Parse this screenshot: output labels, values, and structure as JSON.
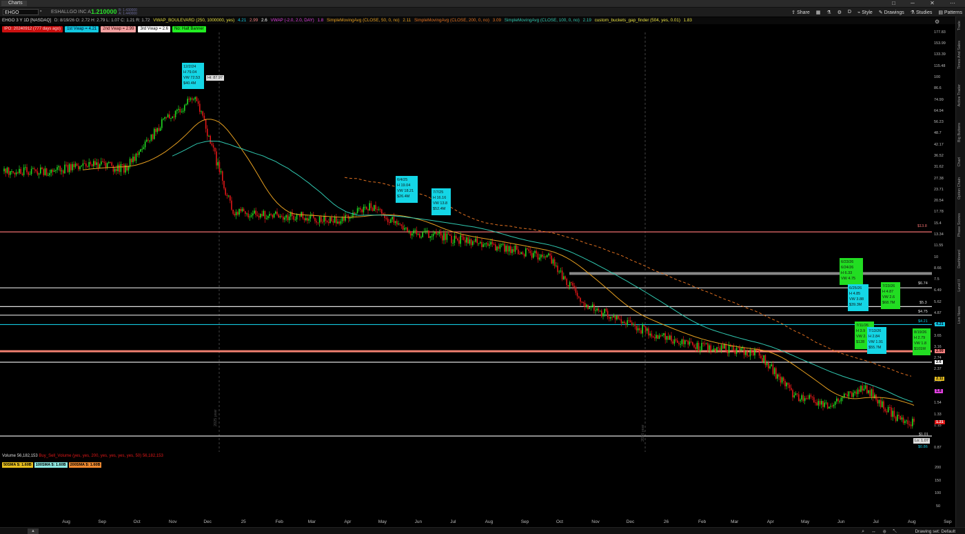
{
  "window": {
    "tab": "Charts"
  },
  "toolbar": {
    "symbol": "EHGO",
    "company": "ESHALLGO INC A",
    "last_price": "1.210000",
    "mini_quote": [
      "B: 1.430000",
      "A: 1.440000"
    ],
    "share": "Share",
    "style": "Style",
    "drawings": "Drawings",
    "studies": "Studies",
    "patterns": "Patterns",
    "d_label": "D"
  },
  "infobar": {
    "title": "EHGO 3 Y 1D [NASDAQ]",
    "ohlc": "D: 8/19/26  O: 2.72  H: 2.79  L: 1.07  C: 1.21  R: 1.72",
    "vwap_blvd": "VWAP_BOULEVARD (250, 1000000, yes)",
    "vwap_blvd_vals": [
      "4.21",
      "2.99",
      "2.6"
    ],
    "vwap": "VWAP (-2.0, 2.0, DAY)",
    "vwap_val": "1.8",
    "sma50": "SimpleMovingAvg (CLOSE, 50, 0, no)",
    "sma50_val": "2.11",
    "sma200": "SimpleMovingAvg (CLOSE, 200, 0, no)",
    "sma200_val": "3.09",
    "sma100": "SimpleMovingAvg (CLOSE, 100, 0, no)",
    "sma100_val": "2.19",
    "gap": "custom_buckets_gap_finder (504, yes, 0.01)",
    "gap_val": "1.83"
  },
  "chips": [
    {
      "text": "IPO: 20240912 (777 days ago)",
      "bg": "#cc1010",
      "fg": "#ffcccc"
    },
    {
      "text": "1st Vwap = 4.21",
      "bg": "#12c8e0",
      "fg": "#002"
    },
    {
      "text": "2nd Vwap = 2.99",
      "bg": "#f2a0a0",
      "fg": "#300"
    },
    {
      "text": "3rd Vwap = 2.6",
      "bg": "#ffffff",
      "fg": "#000"
    },
    {
      "text": "No: Halt Banner",
      "bg": "#22ee22",
      "fg": "#000"
    }
  ],
  "callouts": [
    {
      "type": "c",
      "lines": [
        "12/2/24",
        "H 79.04",
        "VW 72.53",
        "$40.4M"
      ]
    },
    {
      "type": "c",
      "lines": [
        "6/4/25",
        "H 19.04",
        "VW 18.21",
        "$26.4M"
      ]
    },
    {
      "type": "c",
      "lines": [
        "7/7/25",
        "H 16.16",
        "VW 13.8",
        "$52.4M"
      ]
    },
    {
      "type": "g",
      "lines": [
        "6/23/26",
        "6/24/26",
        "H 6.33",
        "VW 4.75"
      ]
    },
    {
      "type": "c",
      "lines": [
        "6/25/26",
        "H 4.85",
        "VW 3.88",
        "$39.3M"
      ]
    },
    {
      "type": "g",
      "lines": [
        "7/23/26",
        "H 4.87",
        "VW 2.6",
        "$68.7M"
      ]
    },
    {
      "type": "g",
      "lines": [
        "7/11/26",
        "H 3.9",
        "VW 2.",
        "$128"
      ]
    },
    {
      "type": "c",
      "lines": [
        "7/13/26",
        "H 2.84",
        "VW 1.91",
        "$55.7M"
      ]
    },
    {
      "type": "g",
      "lines": [
        "8/19/26",
        "H 2.79",
        "VW 1.8",
        "$101M"
      ]
    }
  ],
  "hi_tag": "Hi: 87.97",
  "lo_tag": "Lo: 1.07",
  "year_marks": [
    "2025 year",
    "2026 year"
  ],
  "level_labels": [
    "$13.8",
    "$6.74",
    "$5.3",
    "$4.75",
    "$4.21",
    "$1.01",
    "$0.86"
  ],
  "price_axis": [
    "177.83",
    "153.99",
    "133.39",
    "115.48",
    "100",
    "86.6",
    "74.99",
    "64.94",
    "56.23",
    "48.7",
    "42.17",
    "36.52",
    "31.62",
    "27.38",
    "23.71",
    "20.54",
    "17.78",
    "15.4",
    "13.34",
    "11.55",
    "10",
    "8.66",
    "7.5",
    "6.49",
    "5.62",
    "4.87",
    "4.21",
    "3.65",
    "3.16",
    "2.74",
    "2.37",
    "2.05",
    "1.78",
    "1.54",
    "1.33",
    "1.15",
    "0.87"
  ],
  "price_tags": [
    {
      "text": "4.21",
      "bg": "#12c8e0",
      "fg": "#002"
    },
    {
      "text": "2.99",
      "bg": "#f28080",
      "fg": "#300"
    },
    {
      "text": "2.6",
      "bg": "#ffffff",
      "fg": "#000"
    },
    {
      "text": "2.11",
      "bg": "#e8c020",
      "fg": "#000"
    },
    {
      "text": "1.8",
      "bg": "#e040e0",
      "fg": "#000"
    },
    {
      "text": "1.21",
      "bg": "#e01818",
      "fg": "#fff"
    }
  ],
  "volume": {
    "label": "Volume",
    "value": "56,182,153",
    "study": "Buy_Sell_Volume (yes, yes, 200, yes, yes, yes, yes, 50)",
    "study_val": "56,182,153",
    "axis": [
      "200",
      "150",
      "100",
      "50"
    ],
    "sma_chips": [
      {
        "text": "50SMA $: 1.60B",
        "bg": "#e8c020"
      },
      {
        "text": "100SMA $: 1.60B",
        "bg": "#8ee8e0"
      },
      {
        "text": "200SMA $: 1.60B",
        "bg": "#f08a30"
      }
    ]
  },
  "time_axis": [
    "Aug",
    "Sep",
    "Oct",
    "Nov",
    "Dec",
    "25",
    "Feb",
    "Mar",
    "Apr",
    "May",
    "Jun",
    "Jul",
    "Aug",
    "Sep",
    "Oct",
    "Nov",
    "Dec",
    "26",
    "Feb",
    "Mar",
    "Apr",
    "May",
    "Jun",
    "Jul",
    "Aug",
    "Sep"
  ],
  "sidebar": [
    "Trade",
    "Times And Sales",
    "Active Trader",
    "Big Buttons",
    "Chart",
    "Option Chain",
    "Phase Scores",
    "Dashboard",
    "Level II",
    "Live News"
  ],
  "bottom": {
    "drawing_set": "Drawing set: Default"
  },
  "colors": {
    "up": "#22dd22",
    "down": "#e01818",
    "sma50": "#e8a020",
    "sma100": "#30c8b0",
    "sma200": "#e07020"
  },
  "chart_data": {
    "type": "candlestick",
    "title": "EHGO 3 Y 1D [NASDAQ]",
    "y_scale": "log",
    "ylim": [
      0.86,
      177.83
    ],
    "x_range": [
      "2024-08",
      "2026-09"
    ],
    "closes_approx": [
      {
        "date": "2024-08",
        "close": 30
      },
      {
        "date": "2024-09",
        "close": 33
      },
      {
        "date": "2024-10",
        "close": 31
      },
      {
        "date": "2024-11",
        "close": 55
      },
      {
        "date": "2024-12",
        "close": 79
      },
      {
        "date": "2025-01",
        "close": 18
      },
      {
        "date": "2025-02",
        "close": 17
      },
      {
        "date": "2025-03",
        "close": 17
      },
      {
        "date": "2025-04",
        "close": 16
      },
      {
        "date": "2025-05",
        "close": 19
      },
      {
        "date": "2025-06",
        "close": 14
      },
      {
        "date": "2025-07",
        "close": 13
      },
      {
        "date": "2025-08",
        "close": 12
      },
      {
        "date": "2025-09",
        "close": 11
      },
      {
        "date": "2025-10",
        "close": 10
      },
      {
        "date": "2025-11",
        "close": 5.5
      },
      {
        "date": "2025-12",
        "close": 4.5
      },
      {
        "date": "2026-01",
        "close": 3.7
      },
      {
        "date": "2026-02",
        "close": 3.2
      },
      {
        "date": "2026-03",
        "close": 3.1
      },
      {
        "date": "2026-04",
        "close": 2.9
      },
      {
        "date": "2026-05",
        "close": 1.7
      },
      {
        "date": "2026-06",
        "close": 1.5
      },
      {
        "date": "2026-07",
        "close": 1.9
      },
      {
        "date": "2026-08",
        "close": 1.21
      }
    ],
    "horizontal_levels": [
      13.8,
      6.74,
      5.3,
      4.75,
      4.21,
      2.99,
      2.6,
      1.01
    ],
    "legend": "none"
  }
}
